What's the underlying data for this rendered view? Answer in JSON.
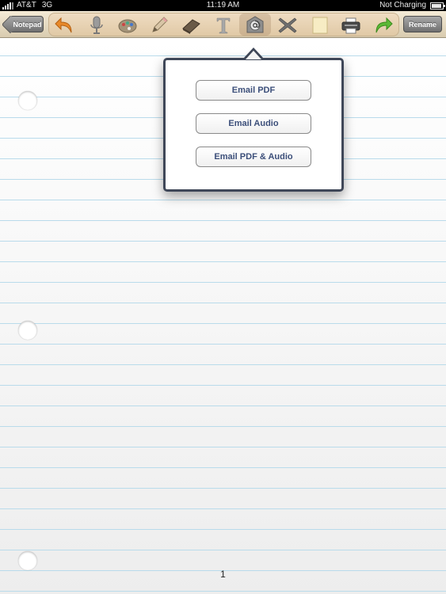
{
  "status_bar": {
    "carrier": "AT&T",
    "network": "3G",
    "time": "11:19 AM",
    "battery_status": "Not Charging"
  },
  "toolbar": {
    "back_label": "Notepad",
    "rename_label": "Rename",
    "tools": [
      {
        "icon": "undo-icon"
      },
      {
        "icon": "microphone-icon"
      },
      {
        "icon": "palette-icon"
      },
      {
        "icon": "pencil-icon"
      },
      {
        "icon": "eraser-icon"
      },
      {
        "icon": "text-icon"
      },
      {
        "icon": "email-icon",
        "active": true
      },
      {
        "icon": "delete-icon"
      },
      {
        "icon": "sticky-note-icon"
      },
      {
        "icon": "printer-icon"
      },
      {
        "icon": "redo-icon"
      }
    ]
  },
  "popover": {
    "options": [
      {
        "label": "Email PDF"
      },
      {
        "label": "Email Audio"
      },
      {
        "label": "Email PDF & Audio"
      }
    ]
  },
  "page": {
    "number": "1"
  },
  "colors": {
    "toolbar_bg": "#e6d8bc",
    "popover_border": "#3f4758",
    "button_text": "#3c4f7a",
    "ruled_line": "#b9dbeb"
  }
}
